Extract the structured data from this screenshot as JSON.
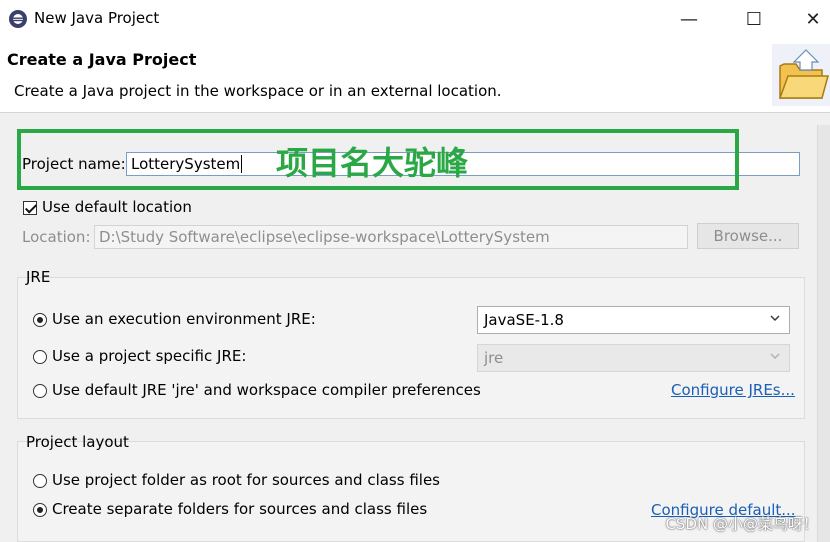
{
  "window": {
    "title": "New Java Project",
    "controls": {
      "minimize": "—",
      "maximize": "☐",
      "close": "✕"
    }
  },
  "banner": {
    "title": "Create a Java Project",
    "description": "Create a Java project in the workspace or in an external location."
  },
  "form": {
    "project_name_label": "Project name:",
    "project_name_value": "LotterySystem",
    "use_default_location_label": "Use default location",
    "location_label": "Location:",
    "location_value": "D:\\Study Software\\eclipse\\eclipse-workspace\\LotterySystem",
    "browse_label": "Browse..."
  },
  "jre": {
    "group_title": "JRE",
    "option_exec_env": "Use an execution environment JRE:",
    "exec_env_value": "JavaSE-1.8",
    "option_project_specific": "Use a project specific JRE:",
    "project_specific_value": "jre",
    "option_default": "Use default JRE 'jre' and workspace compiler preferences",
    "configure_link": "Configure JREs..."
  },
  "layout": {
    "group_title": "Project layout",
    "option_root": "Use project folder as root for sources and class files",
    "option_separate": "Create separate folders for sources and class files",
    "configure_link": "Configure default..."
  },
  "annotation": {
    "text": "项目名大驼峰",
    "color": "#2aa846"
  },
  "watermark": "CSDN @小@菜鸟呀！",
  "colors": {
    "link": "#1a5fb4",
    "annotation_green": "#2aa846"
  }
}
